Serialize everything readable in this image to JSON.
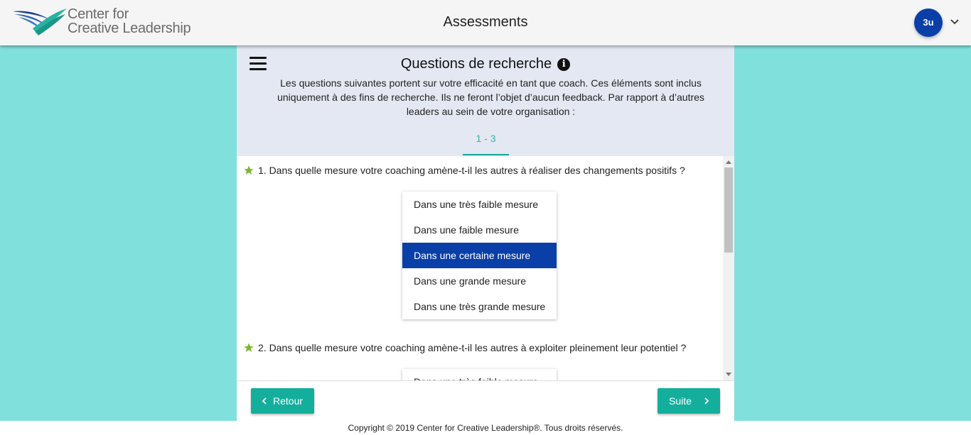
{
  "header": {
    "logo_line1": "Center for",
    "logo_line2": "Creative Leadership",
    "title": "Assessments",
    "user_initials": "3u"
  },
  "section": {
    "title": "Questions de recherche",
    "intro": "Les questions suivantes portent sur votre efficacité en tant que coach. Ces éléments sont inclus uniquement à des fins de recherche. Ils ne feront l’objet d’aucun feedback. Par rapport à d’autres leaders au sein de votre organisation :",
    "page_tab": "1 - 3"
  },
  "questions": [
    {
      "text": "1. Dans quelle mesure votre coaching amène-t-il les autres à réaliser des changements positifs ?",
      "options": [
        "Dans une très faible mesure",
        "Dans une faible mesure",
        "Dans une certaine mesure",
        "Dans une grande mesure",
        "Dans une très grande mesure"
      ],
      "selected_index": 2
    },
    {
      "text": "2. Dans quelle mesure votre coaching amène-t-il les autres à exploiter pleinement leur potentiel ?",
      "options": [
        "Dans une très faible mesure"
      ]
    }
  ],
  "nav": {
    "back_label": "Retour",
    "next_label": "Suite"
  },
  "footer": {
    "copyright": "Copyright © 2019 Center for Creative Leadership®. Tous droits réservés."
  },
  "colors": {
    "background": "#80e0dc",
    "accent": "#14ae9c",
    "selected": "#0a3fa8",
    "star": "#7cb82f"
  }
}
